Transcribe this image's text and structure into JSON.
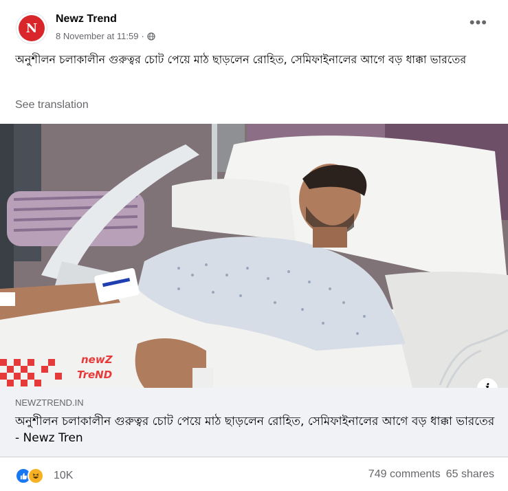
{
  "post": {
    "page_name": "Newz Trend",
    "timestamp": "8 November at 11:59",
    "separator": "·",
    "avatar_text": "N",
    "text": "অনুশীলন চলাকালীন গুরুত্বর চোট পেয়ে মাঠ ছাড়লেন রোহিত, সেমিফাইনালের আগে বড় ধাক্কা ভারতের",
    "see_translation": "See translation",
    "more_label": "•••"
  },
  "image": {
    "watermark_line1": "newZ",
    "watermark_line2": "TreND",
    "info_label": "i"
  },
  "link": {
    "domain": "NEWZTREND.IN",
    "title": "অনুশীলন চলাকালীন গুরুত্বর চোট পেয়ে মাঠ ছাড়লেন রোহিত, সেমিফাইনালের আগে বড় ধাক্কা ভারতের - Newz Tren"
  },
  "stats": {
    "reaction_count": "10K",
    "comments": "749 comments",
    "shares": "65 shares"
  },
  "colors": {
    "accent": "#1877f2",
    "haha": "#f7b125",
    "brand_red": "#d9262b"
  }
}
